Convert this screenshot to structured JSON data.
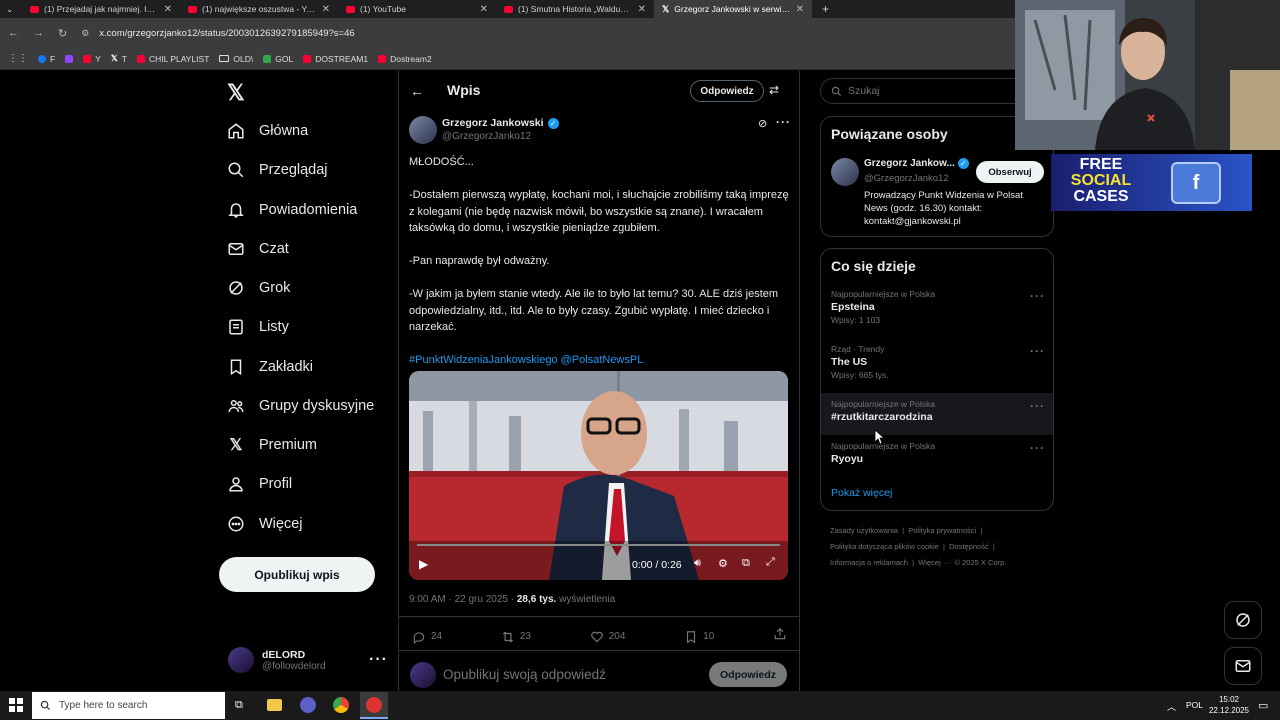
{
  "browser": {
    "tabs": [
      {
        "title": "(1) Przejadaj jak najmniej. Inwe",
        "icon": "youtube-icon"
      },
      {
        "title": "(1) największe oszustwa - YouTu",
        "icon": "youtube-icon"
      },
      {
        "title": "(1) YouTube",
        "icon": "youtube-icon"
      },
      {
        "title": "(1) Smutna Historia „Waldusia z",
        "icon": "youtube-icon"
      },
      {
        "title": "Grzegorz Jankowski w serwisie",
        "icon": "x-icon",
        "active": true
      }
    ],
    "url": "x.com/grzegorzjanko12/status/2003012639279185949?s=46",
    "bookmarks": [
      "F",
      "",
      "Y",
      "T",
      "CHIL PLAYLIST",
      "OLD\\",
      "GOL",
      "DOSTREAM1",
      "Dostream2"
    ]
  },
  "nav": {
    "items": [
      {
        "label": "Główna",
        "icon": "home-icon"
      },
      {
        "label": "Przeglądaj",
        "icon": "search-icon"
      },
      {
        "label": "Powiadomienia",
        "icon": "bell-icon"
      },
      {
        "label": "Czat",
        "icon": "mail-icon"
      },
      {
        "label": "Grok",
        "icon": "grok-icon"
      },
      {
        "label": "Listy",
        "icon": "list-icon"
      },
      {
        "label": "Zakładki",
        "icon": "bookmark-icon"
      },
      {
        "label": "Grupy dyskusyjne",
        "icon": "people-icon"
      },
      {
        "label": "Premium",
        "icon": "x-icon"
      },
      {
        "label": "Profil",
        "icon": "person-icon"
      },
      {
        "label": "Więcej",
        "icon": "more-icon"
      }
    ],
    "post_button": "Opublikuj wpis",
    "user": {
      "name": "dELORD",
      "handle": "@followdelord"
    }
  },
  "post": {
    "header_title": "Wpis",
    "reply_button": "Odpowiedz",
    "author": {
      "name": "Grzegorz Jankowski",
      "handle": "@GrzegorzJanko12"
    },
    "paragraphs": [
      "MŁODOŚĆ...",
      "-Dostałem pierwszą wypłatę, kochani moi, i słuchajcie zrobiliśmy taką imprezę z kolegami (nie będę nazwisk mówił, bo wszystkie są znane). I wracałem taksówką do domu, i wszystkie pieniądze zgubiłem.",
      "-Pan naprawdę był odważny.",
      "-W jakim ja byłem stanie wtedy. Ale ile to było lat temu? 30. ALE dziś jestem odpowiedzialny, itd., itd. Ale to były czasy. Zgubić wypłatę. I mieć dziecko i narzekać."
    ],
    "hashtags": "#PunktWidzeniaJankowskiego @PolsatNewsPL",
    "video": {
      "time": "0:00 / 0:26",
      "progress": 0.0
    },
    "meta": {
      "time": "9:00 AM · 22 gru 2025 · ",
      "views": "28,6 tys.",
      "views_label": " wyświetlenia"
    },
    "stats": {
      "replies": "24",
      "reposts": "23",
      "likes": "204",
      "bookmarks": "10"
    },
    "reply_placeholder": "Opublikuj swoją odpowiedź",
    "reply_submit": "Odpowiedz"
  },
  "sidebar": {
    "search_placeholder": "Szukaj",
    "related": {
      "title": "Powiązane osoby",
      "name": "Grzegorz Jankow...",
      "handle": "@GrzegorzJanko12",
      "follow": "Obserwuj",
      "bio": "Prowadzący Punkt Widzenia w Polsat News (godz. 16.30) kontakt: kontakt@gjankowski.pl"
    },
    "trends": {
      "title": "Co się dzieje",
      "items": [
        {
          "meta": "Najpopularniejsze w Polska",
          "name": "Epsteina",
          "count": "Wpisy: 1 103"
        },
        {
          "meta": "Rząd · Trendy",
          "name": "The US",
          "count": "Wpisy: 665 tys."
        },
        {
          "meta": "Najpopularniejsze w Polska",
          "name": "#rzutkitarczarodzina",
          "count": ""
        },
        {
          "meta": "Najpopularniejsze w Polska",
          "name": "Ryoyu",
          "count": ""
        }
      ],
      "show_more": "Pokaż więcej"
    },
    "footer": [
      "Zasady użytkowania",
      "Polityka prywatności",
      "Polityka dotycząca plików cookie",
      "Dostępność",
      "Informacja o reklamach",
      "Więcej ···",
      "© 2025 X Corp."
    ]
  },
  "ad": {
    "text1": "FREE",
    "text2": "SOCIAL",
    "text3": "CASES"
  },
  "taskbar": {
    "search": "Type here to search",
    "lang": "POL",
    "time": "15:02",
    "date": "22.12.2025"
  }
}
